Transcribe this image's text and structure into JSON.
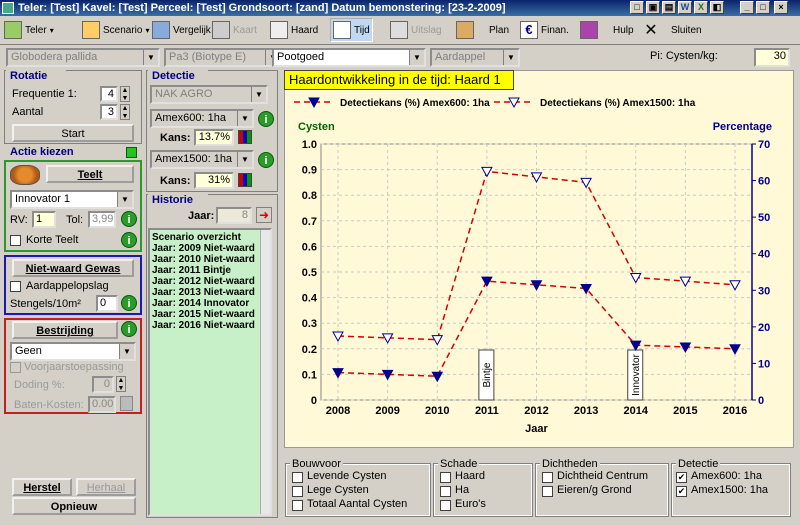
{
  "titlebar": {
    "text": "Teler: [Test] Kavel: [Test] Perceel: [Test] Grondsoort: [zand] Datum bemonstering: [23-2-2009]"
  },
  "toolbar": {
    "teler": "Teler",
    "scenario": "Scenario",
    "vergelijk": "Vergelijk",
    "kaart": "Kaart",
    "haard": "Haard",
    "tijd": "Tijd",
    "uitslag": "Uitslag",
    "plan": "Plan",
    "finan": "Finan.",
    "hulp": "Hulp",
    "sluiten": "Sluiten"
  },
  "filters": {
    "species": "Globodera pallida",
    "biotype": "Pa3  (Biotype E)",
    "category": "Pootgoed",
    "crop": "Aardappel",
    "pi_label": "Pi: Cysten/kg:",
    "pi_value": "30"
  },
  "rotatie": {
    "title": "Rotatie",
    "freq_label": "Frequentie 1:",
    "freq_value": "4",
    "aantal_label": "Aantal",
    "aantal_value": "3",
    "start": "Start"
  },
  "actie": {
    "title": "Actie kiezen",
    "teelt": "Teelt",
    "variety": "Innovator 1",
    "rv_label": "RV:",
    "rv_value": "1",
    "tol_label": "Tol:",
    "tol_value": "3,99",
    "korte_teelt": "Korte Teelt",
    "niet_waard": "Niet-waard Gewas",
    "aardappelopslag": "Aardappelopslag",
    "stengels_label": "Stengels/10m²",
    "stengels_value": "0",
    "bestrijding": "Bestrijding",
    "bestrijding_value": "Geen",
    "voorjaar": "Voorjaarstoepassing",
    "doding_label": "Doding %:",
    "doding_value": "0",
    "baten_label": "Baten-Kosten:",
    "baten_value": "0.00",
    "herstel": "Herstel",
    "herhaal": "Herhaal",
    "opnieuw": "Opnieuw"
  },
  "detectie": {
    "title": "Detectie",
    "lab": "NAK AGRO",
    "method1": "Amex600: 1ha",
    "kans_label": "Kans:",
    "kans1": "13.7%",
    "method2": "Amex1500: 1ha",
    "kans2": "31%"
  },
  "historie": {
    "title": "Historie",
    "jaar_label": "Jaar:",
    "jaar_value": "8",
    "items": [
      "Scenario overzicht",
      "Jaar: 2009 Niet-waard",
      "Jaar: 2010 Niet-waard",
      "Jaar: 2011 Bintje",
      "Jaar: 2012 Niet-waard",
      "Jaar: 2013 Niet-waard",
      "Jaar: 2014 Innovator",
      "Jaar: 2015 Niet-waard",
      "Jaar: 2016 Niet-waard"
    ]
  },
  "chart_data": {
    "type": "line",
    "title": "Haardontwikkeling in de tijd: Haard 1",
    "xlabel": "Jaar",
    "ylabel_left": "Cysten",
    "ylabel_right": "Percentage",
    "x": [
      2008,
      2009,
      2010,
      2011,
      2012,
      2013,
      2014,
      2015,
      2016
    ],
    "ylim_left": [
      0,
      1.0
    ],
    "yticks_left": [
      "0",
      "0.1",
      "0.2",
      "0.3",
      "0.4",
      "0.5",
      "0.6",
      "0.7",
      "0.8",
      "0.9",
      "1.0"
    ],
    "ylim_right": [
      0,
      70
    ],
    "yticks_right": [
      "0",
      "10",
      "20",
      "30",
      "40",
      "50",
      "60",
      "70"
    ],
    "grid": true,
    "legend": "top",
    "series": [
      {
        "name": "Detectiekans (%) Amex600: 1ha",
        "axis": "right",
        "marker": "filled-triangle-down",
        "values": [
          7.5,
          7.0,
          6.5,
          32.5,
          31.5,
          30.5,
          15.0,
          14.5,
          14.0
        ]
      },
      {
        "name": "Detectiekans (%) Amex1500: 1ha",
        "axis": "right",
        "marker": "open-triangle-down",
        "values": [
          17.5,
          17.0,
          16.5,
          62.5,
          61.0,
          59.5,
          33.5,
          32.5,
          31.5
        ]
      }
    ],
    "annotations": [
      {
        "x": 2011,
        "text": "Bintje"
      },
      {
        "x": 2014,
        "text": "Innovator"
      }
    ],
    "colors": {
      "line": "#d40000",
      "marker": "#00008b",
      "axis_right": "#00008b",
      "cysten": "#006400"
    }
  },
  "bottom": {
    "bouwvoor": {
      "title": "Bouwvoor",
      "items": [
        "Levende Cysten",
        "Lege Cysten",
        "Totaal Aantal Cysten"
      ]
    },
    "schade": {
      "title": "Schade",
      "items": [
        "Haard",
        "Ha",
        "Euro's"
      ]
    },
    "dichtheden": {
      "title": "Dichtheden",
      "items": [
        "Dichtheid Centrum",
        "Eieren/g Grond"
      ]
    },
    "detectie": {
      "title": "Detectie",
      "items": [
        "Amex600: 1ha",
        "Amex1500: 1ha"
      ]
    }
  }
}
